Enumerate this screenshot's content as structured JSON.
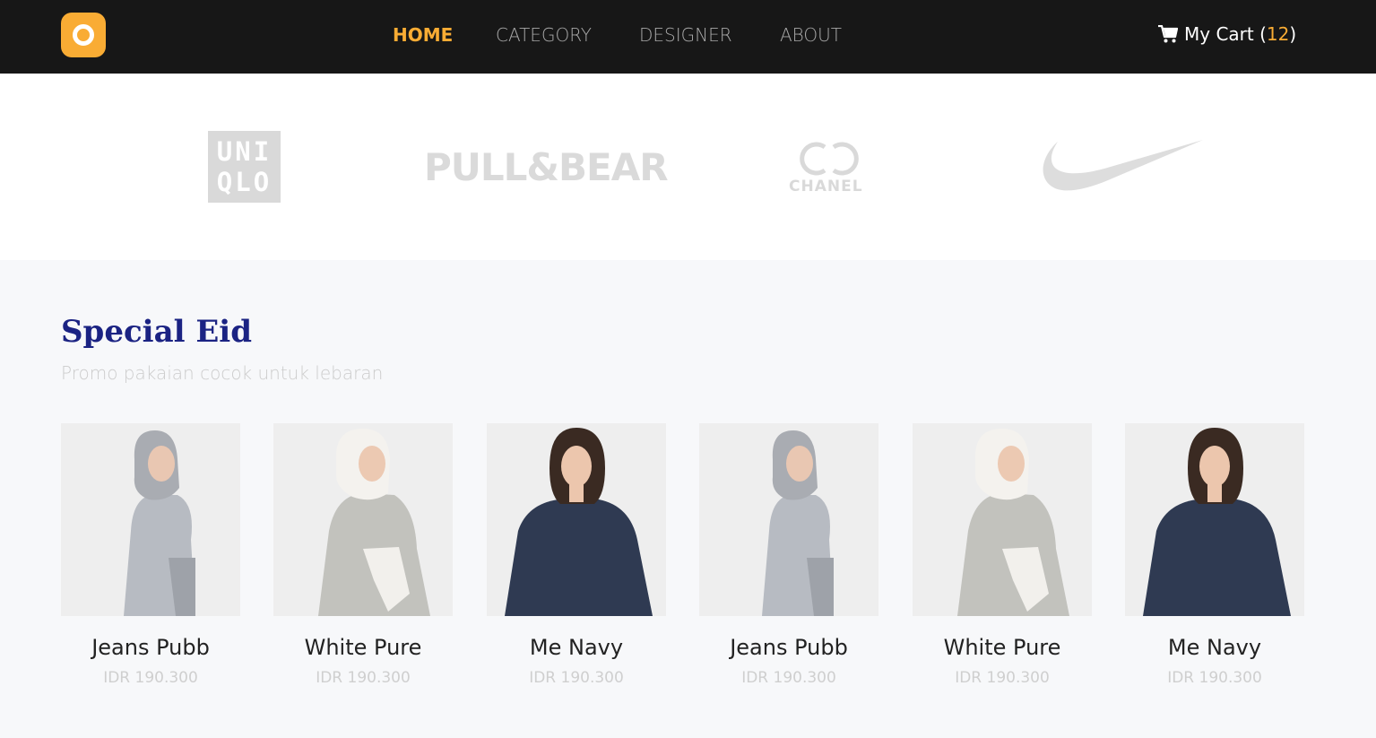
{
  "nav": {
    "links": [
      "HOME",
      "CATEGORY",
      "DESIGNER",
      "ABOUT"
    ],
    "cart_label": "My Cart (",
    "cart_count": "12",
    "cart_close": ")"
  },
  "brands": {
    "uniqlo_line1": "UNI",
    "uniqlo_line2": "QLO",
    "pullbear": "PULL&BEAR",
    "chanel": "CHANEL"
  },
  "section": {
    "title": "Special Eid",
    "subtitle": "Promo pakaian cocok untuk lebaran"
  },
  "products": [
    {
      "name": "Jeans Pubb",
      "price": "IDR 190.300",
      "style": "grey-hijab"
    },
    {
      "name": "White Pure",
      "price": "IDR 190.300",
      "style": "white-hijab"
    },
    {
      "name": "Me Navy",
      "price": "IDR 190.300",
      "style": "navy-dress"
    },
    {
      "name": "Jeans Pubb",
      "price": "IDR 190.300",
      "style": "grey-hijab"
    },
    {
      "name": "White Pure",
      "price": "IDR 190.300",
      "style": "white-hijab"
    },
    {
      "name": "Me Navy",
      "price": "IDR 190.300",
      "style": "navy-dress"
    }
  ],
  "colors": {
    "accent": "#f9ac34",
    "navbar": "#171717",
    "title": "#1b2383",
    "section_bg": "#f7f8fa"
  }
}
